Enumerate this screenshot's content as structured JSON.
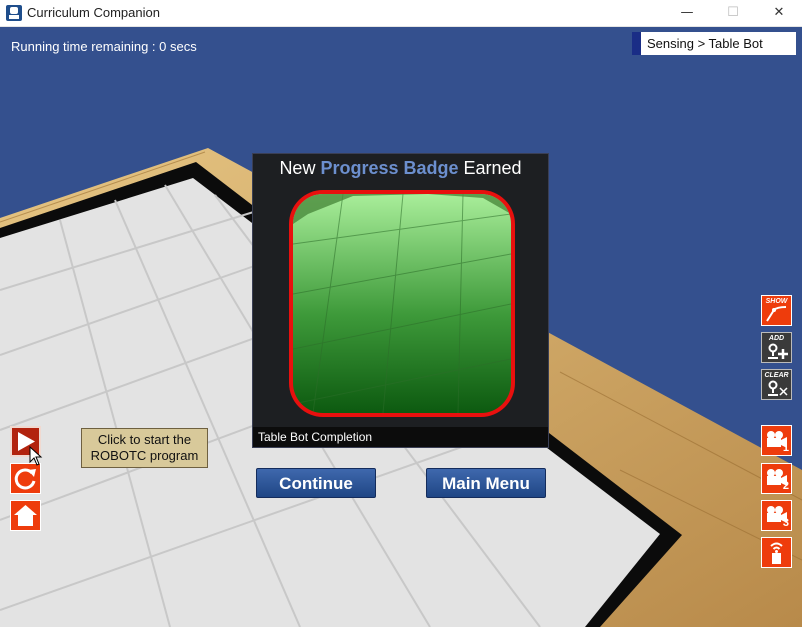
{
  "window": {
    "title": "Curriculum Companion",
    "controls": {
      "minimize": "—",
      "maximize": "☐",
      "close": "✕"
    }
  },
  "hud": {
    "running_time": "Running time remaining : 0 secs",
    "breadcrumb": "Sensing > Table Bot"
  },
  "badge_dialog": {
    "title_prefix": "New ",
    "title_highlight": "Progress Badge",
    "title_suffix": " Earned",
    "caption": "Table Bot Completion",
    "badge_icon": "green-grid-badge-icon"
  },
  "buttons": {
    "continue": "Continue",
    "main_menu": "Main Menu"
  },
  "left_controls": {
    "tooltip_line1": "Click to start the",
    "tooltip_line2": "ROBOTC program",
    "play_icon": "play-icon",
    "reset_icon": "reset-icon",
    "home_icon": "home-icon"
  },
  "right_controls": {
    "show_label": "SHOW",
    "add_label": "ADD",
    "clear_label": "CLEAR",
    "cam1_number": "1",
    "cam2_number": "2",
    "cam3_number": "3"
  },
  "colors": {
    "scene_background": "#34508e",
    "accent_orange": "#ee3c0c",
    "button_blue": "#2c55a0",
    "badge_red": "#e8100e",
    "title_highlight": "#6c8fce"
  }
}
